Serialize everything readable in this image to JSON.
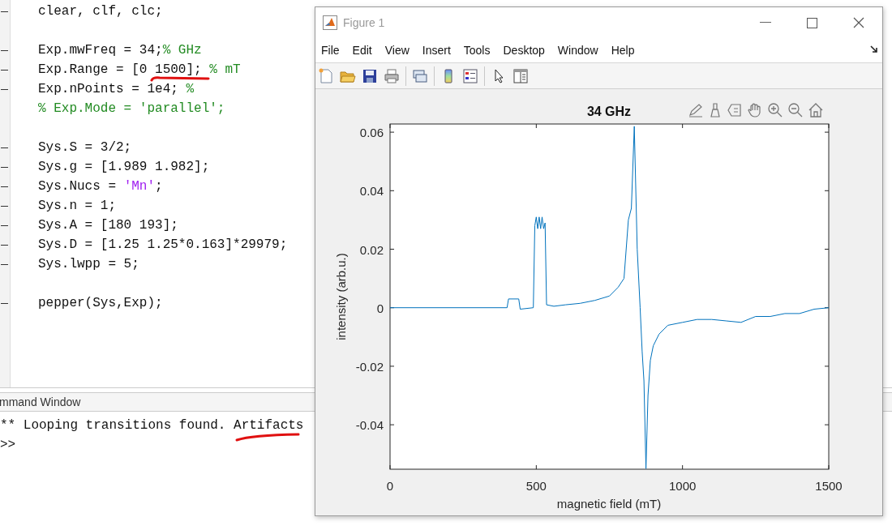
{
  "editor": {
    "lines": [
      {
        "executable": true,
        "gap_before": false,
        "segments": [
          {
            "kind": "code",
            "text": "clear, clf, clc;"
          }
        ]
      },
      {
        "executable": true,
        "gap_before": true,
        "segments": [
          {
            "kind": "code",
            "text": "Exp.mwFreq = 34;"
          },
          {
            "kind": "comment",
            "text": "% GHz"
          }
        ]
      },
      {
        "executable": true,
        "gap_before": false,
        "segments": [
          {
            "kind": "code",
            "text": "Exp.Range = [0 1500]; "
          },
          {
            "kind": "comment",
            "text": "% mT"
          }
        ]
      },
      {
        "executable": true,
        "gap_before": false,
        "segments": [
          {
            "kind": "code",
            "text": "Exp.nPoints = 1e4; "
          },
          {
            "kind": "comment",
            "text": "%"
          }
        ]
      },
      {
        "executable": false,
        "gap_before": false,
        "segments": [
          {
            "kind": "comment",
            "text": "% Exp.Mode = 'parallel';"
          }
        ]
      },
      {
        "executable": true,
        "gap_before": true,
        "segments": [
          {
            "kind": "code",
            "text": "Sys.S = 3/2;"
          }
        ]
      },
      {
        "executable": true,
        "gap_before": false,
        "segments": [
          {
            "kind": "code",
            "text": "Sys.g = [1.989 1.982];"
          }
        ]
      },
      {
        "executable": true,
        "gap_before": false,
        "segments": [
          {
            "kind": "code",
            "text": "Sys.Nucs = "
          },
          {
            "kind": "string",
            "text": "'Mn'"
          },
          {
            "kind": "code",
            "text": ";"
          }
        ]
      },
      {
        "executable": true,
        "gap_before": false,
        "segments": [
          {
            "kind": "code",
            "text": "Sys.n = 1;"
          }
        ]
      },
      {
        "executable": true,
        "gap_before": false,
        "segments": [
          {
            "kind": "code",
            "text": "Sys.A = [180 193];"
          }
        ]
      },
      {
        "executable": true,
        "gap_before": false,
        "segments": [
          {
            "kind": "code",
            "text": "Sys.D = [1.25 1.25*0.163]*29979;"
          }
        ]
      },
      {
        "executable": true,
        "gap_before": false,
        "segments": [
          {
            "kind": "code",
            "text": "Sys.lwpp = 5;"
          }
        ]
      },
      {
        "executable": true,
        "gap_before": true,
        "segments": [
          {
            "kind": "code",
            "text": "pepper(Sys,Exp);"
          }
        ]
      }
    ]
  },
  "command_window": {
    "title": "mmand Window",
    "lines": [
      "** Looping transitions found. Artifacts",
      ">>"
    ]
  },
  "figure": {
    "title": "Figure 1",
    "menu": [
      "File",
      "Edit",
      "View",
      "Insert",
      "Tools",
      "Desktop",
      "Window",
      "Help"
    ],
    "chart_data": {
      "type": "line",
      "title": "34 GHz",
      "xlabel": "magnetic field (mT)",
      "ylabel": "intensity (arb.u.)",
      "x": [
        0,
        400,
        405,
        440,
        445,
        490,
        495,
        500,
        505,
        510,
        515,
        520,
        525,
        530,
        535,
        560,
        600,
        650,
        700,
        750,
        780,
        800,
        815,
        825,
        835,
        845,
        855,
        862,
        868,
        875,
        882,
        890,
        900,
        920,
        950,
        1000,
        1050,
        1100,
        1150,
        1200,
        1250,
        1300,
        1350,
        1400,
        1450,
        1500
      ],
      "series": [
        {
          "color": "#0072bd",
          "values": [
            0,
            0,
            0.003,
            0.003,
            -0.0005,
            0,
            0.028,
            0.031,
            0.027,
            0.031,
            0.027,
            0.031,
            0.027,
            0.029,
            0.001,
            0.0005,
            0.001,
            0.0015,
            0.0025,
            0.004,
            0.007,
            0.01,
            0.03,
            0.034,
            0.062,
            0.02,
            0,
            -0.015,
            -0.025,
            -0.055,
            -0.03,
            -0.018,
            -0.013,
            -0.009,
            -0.006,
            -0.005,
            -0.004,
            -0.004,
            -0.0045,
            -0.005,
            -0.003,
            -0.003,
            -0.002,
            -0.002,
            -0.0005,
            0
          ]
        }
      ],
      "xlim": [
        0,
        1500
      ],
      "ylim": [
        -0.0552,
        0.0628
      ],
      "xticks": [
        0,
        500,
        1000,
        1500
      ],
      "yticks": [
        -0.04,
        -0.02,
        0,
        0.02,
        0.04,
        0.06
      ]
    }
  }
}
